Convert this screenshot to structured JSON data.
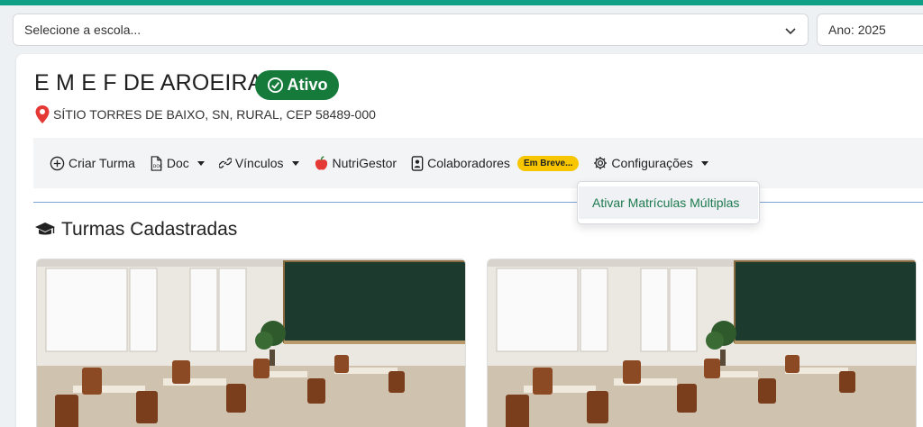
{
  "school_selector": {
    "placeholder": "Selecione a escola...",
    "icon": "chevron-down-icon"
  },
  "year_selector": {
    "label": "Ano: 2025"
  },
  "school": {
    "name": "E M E F DE AROEIRAS",
    "status": "Ativo",
    "address": "SÍTIO TORRES DE BAIXO, SN, RURAL, CEP 58489-000"
  },
  "toolbar": {
    "criar_turma": "Criar Turma",
    "doc": "Doc",
    "vinculos": "Vínculos",
    "nutrigestor": "NutriGestor",
    "colaboradores": "Colaboradores",
    "em_breve": "Em Breve...",
    "configuracoes": "Configurações"
  },
  "dropdown": {
    "items": [
      "Ativar Matrículas Múltiplas"
    ]
  },
  "section": {
    "title": "Turmas Cadastradas"
  },
  "colors": {
    "accent": "#0e9f85",
    "status_green": "#167a3b",
    "badge_yellow": "#f7c600",
    "link_green": "#1d7a4f"
  }
}
